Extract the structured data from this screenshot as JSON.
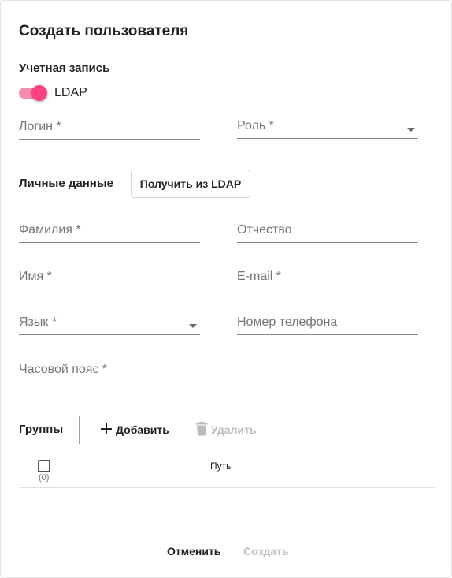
{
  "dialog": {
    "title": "Создать пользователя"
  },
  "account": {
    "section_label": "Учетная запись",
    "ldap_toggle": {
      "label": "LDAP",
      "checked": true
    },
    "login_label": "Логин *",
    "role_label": "Роль *"
  },
  "personal": {
    "section_label": "Личные данные",
    "get_from_ldap_label": "Получить из LDAP",
    "last_name_label": "Фамилия *",
    "middle_name_label": "Отчество",
    "first_name_label": "Имя *",
    "email_label": "E-mail *",
    "language_label": "Язык *",
    "phone_label": "Номер телефона",
    "timezone_label": "Часовой пояс *"
  },
  "groups": {
    "section_label": "Группы",
    "add_label": "Добавить",
    "delete_label": "Удалить",
    "selected_count": "(0)",
    "path_column": "Путь"
  },
  "footer": {
    "cancel_label": "Отменить",
    "create_label": "Создать"
  },
  "colors": {
    "accent": "#ff4081",
    "accent_track": "#f48fb1",
    "disabled": "#bdbdbd"
  },
  "icons": {
    "add": "plus-icon",
    "delete": "trash-icon"
  }
}
